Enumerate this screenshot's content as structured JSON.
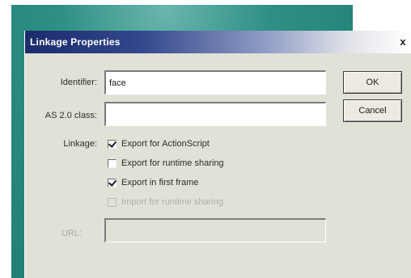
{
  "dialog": {
    "title": "Linkage Properties",
    "close_glyph": "x"
  },
  "fields": {
    "identifier_label": "Identifier:",
    "identifier_value": "face",
    "as2_class_label": "AS 2.0 class:",
    "as2_class_value": "",
    "url_label": "URL:",
    "url_value": ""
  },
  "linkage": {
    "label": "Linkage:",
    "options": [
      {
        "label": "Export for ActionScript",
        "checked": true,
        "enabled": true
      },
      {
        "label": "Export for runtime sharing",
        "checked": false,
        "enabled": true
      },
      {
        "label": "Export in first frame",
        "checked": true,
        "enabled": true
      },
      {
        "label": "Import for runtime sharing",
        "checked": false,
        "enabled": false
      }
    ]
  },
  "buttons": {
    "ok_label": "OK",
    "cancel_label": "Cancel"
  },
  "colors": {
    "backdrop": "#2e8f85",
    "titlebar_start": "#1a2c6b",
    "dialog_face": "#e2e1d8"
  }
}
